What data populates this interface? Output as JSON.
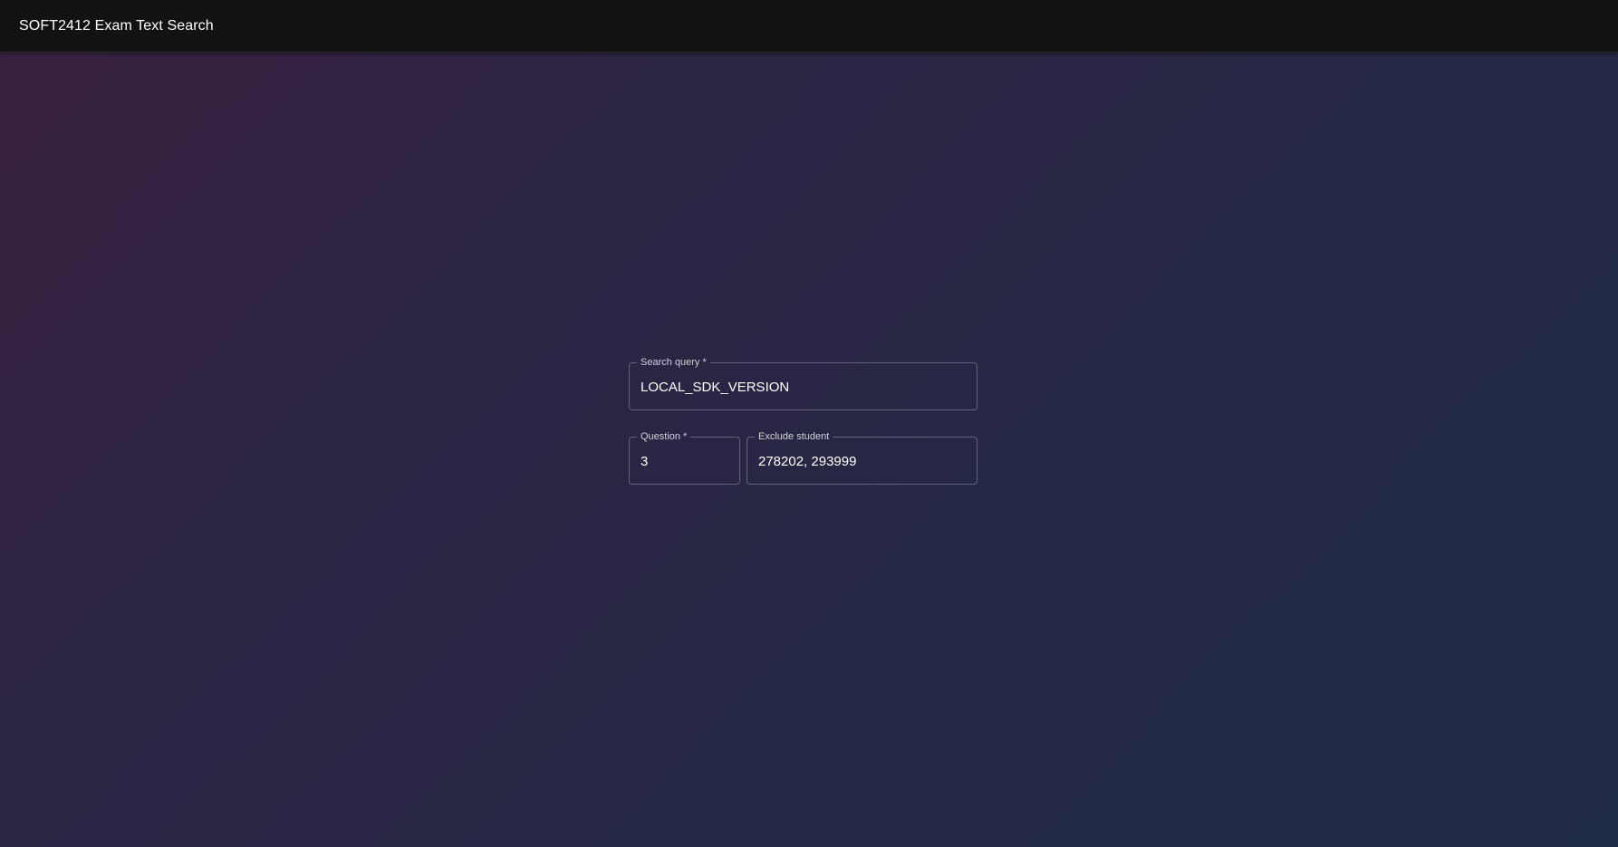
{
  "app_bar": {
    "title": "SOFT2412 Exam Text Search"
  },
  "form": {
    "search_query": {
      "label": "Search query *",
      "value": "LOCAL_SDK_VERSION"
    },
    "question": {
      "label": "Question *",
      "value": "3"
    },
    "exclude_student": {
      "label": "Exclude student",
      "value": "278202, 293999"
    }
  },
  "colors": {
    "app_bar_bg": "#121212",
    "gradient_start": "#3a2140",
    "gradient_end": "#1f2a47",
    "field_border": "rgba(255,255,255,0.28)",
    "text": "#ffffff"
  }
}
